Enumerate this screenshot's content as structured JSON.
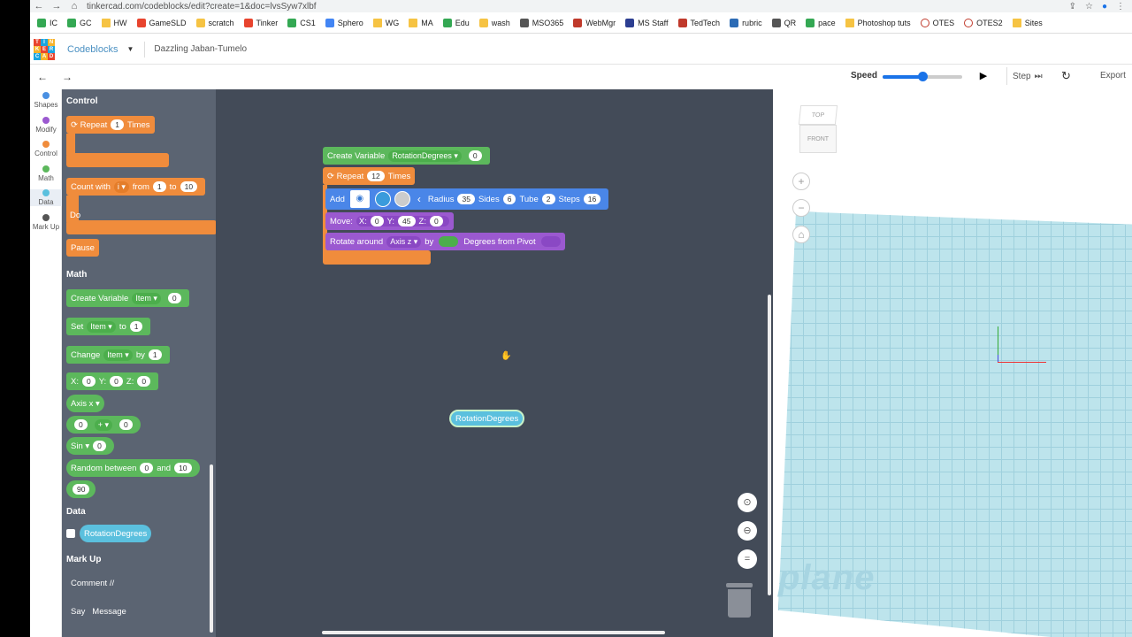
{
  "browser": {
    "url": "tinkercad.com/codeblocks/edit?create=1&doc=lvsSyw7xlbf",
    "bookmarks": [
      {
        "label": "IC",
        "color": "#34a853",
        "kind": "square"
      },
      {
        "label": "GC",
        "color": "#34a853",
        "kind": "square"
      },
      {
        "label": "HW",
        "color": "#f6c343",
        "kind": "folder"
      },
      {
        "label": "GameSLD",
        "color": "#e8442e",
        "kind": "square"
      },
      {
        "label": "scratch",
        "color": "#f6c343",
        "kind": "square"
      },
      {
        "label": "Tinker",
        "color": "#e8442e",
        "kind": "square"
      },
      {
        "label": "CS1",
        "color": "#34a853",
        "kind": "square"
      },
      {
        "label": "Sphero",
        "color": "#4285f4",
        "kind": "square"
      },
      {
        "label": "WG",
        "color": "#f6c343",
        "kind": "folder"
      },
      {
        "label": "MA",
        "color": "#f6c343",
        "kind": "folder"
      },
      {
        "label": "Edu",
        "color": "#34a853",
        "kind": "square"
      },
      {
        "label": "wash",
        "color": "#f6c343",
        "kind": "square"
      },
      {
        "label": "MSO365",
        "color": "#555555",
        "kind": "square"
      },
      {
        "label": "WebMgr",
        "color": "#c0392b",
        "kind": "square"
      },
      {
        "label": "MS Staff",
        "color": "#2c3e91",
        "kind": "square"
      },
      {
        "label": "TedTech",
        "color": "#c0392b",
        "kind": "square"
      },
      {
        "label": "rubric",
        "color": "#2c6bb5",
        "kind": "square"
      },
      {
        "label": "QR",
        "color": "#555555",
        "kind": "square"
      },
      {
        "label": "pace",
        "color": "#34a853",
        "kind": "square"
      },
      {
        "label": "Photoshop tuts",
        "color": "#f6c343",
        "kind": "folder"
      },
      {
        "label": "OTES",
        "color": "#c0392b",
        "kind": "ring"
      },
      {
        "label": "OTES2",
        "color": "#c0392b",
        "kind": "ring"
      },
      {
        "label": "Sites",
        "color": "#f6c343",
        "kind": "folder"
      }
    ]
  },
  "header": {
    "logo_letters": [
      "TIN",
      "KER",
      "CAD"
    ],
    "app_title": "Codeblocks",
    "project_name": "Dazzling Jaban-Tumelo"
  },
  "toolbar": {
    "undo": "←",
    "redo": "→",
    "speed_label": "Speed",
    "speed_value": 0.5,
    "step_label": "Step",
    "export_label": "Export"
  },
  "categories": [
    {
      "label": "Shapes",
      "color": "#4a90e2"
    },
    {
      "label": "Modify",
      "color": "#9b59d0"
    },
    {
      "label": "Control",
      "color": "#f08c3c"
    },
    {
      "label": "Math",
      "color": "#5cb85c"
    },
    {
      "label": "Data",
      "color": "#5bc0de"
    },
    {
      "label": "Mark Up",
      "color": "#555555"
    }
  ],
  "palette": {
    "control_heading": "Control",
    "repeat_label": "Repeat",
    "repeat_count": "1",
    "times_label": "Times",
    "count_with": "Count with",
    "count_var": "i",
    "from_label": "from",
    "from_val": "1",
    "to_label": "to",
    "to_val": "10",
    "do_label": "Do",
    "pause_label": "Pause",
    "math_heading": "Math",
    "create_var_label": "Create Variable",
    "create_var_name": "Item",
    "create_var_val": "0",
    "set_label": "Set",
    "set_var": "Item",
    "set_to": "to",
    "set_val": "1",
    "change_label": "Change",
    "change_var": "Item",
    "change_by": "by",
    "change_val": "1",
    "xyz_x": "X:",
    "xyz_x_val": "0",
    "xyz_y": "Y:",
    "xyz_y_val": "0",
    "xyz_z": "Z:",
    "xyz_z_val": "0",
    "axis_label": "Axis x",
    "op_a": "0",
    "op_sym": "+",
    "op_b": "0",
    "sin_label": "Sin",
    "sin_val": "0",
    "random_label": "Random between",
    "random_a": "0",
    "random_and": "and",
    "random_b": "10",
    "number_val": "90",
    "data_heading": "Data",
    "data_var": "RotationDegrees",
    "markup_heading": "Mark Up",
    "comment_label": "Comment //",
    "say_label": "Say",
    "say_message": "Message"
  },
  "workspace": {
    "create_var_label": "Create Variable",
    "create_var_name": "RotationDegrees",
    "create_var_val": "0",
    "repeat_label": "Repeat",
    "repeat_count": "12",
    "times_label": "Times",
    "add_label": "Add",
    "radius_label": "Radius",
    "radius_val": "35",
    "sides_label": "Sides",
    "sides_val": "6",
    "tube_label": "Tube",
    "tube_val": "2",
    "steps_label": "Steps",
    "steps_val": "16",
    "move_label": "Move:",
    "move_x_label": "X:",
    "move_x_val": "0",
    "move_y_label": "Y:",
    "move_y_val": "45",
    "move_z_label": "Z:",
    "move_z_val": "0",
    "rotate_label": "Rotate around",
    "rotate_axis": "Axis z",
    "rotate_by": "by",
    "rotate_degrees": "Degrees",
    "rotate_from": "from Pivot",
    "floating_var": "RotationDegrees",
    "shape_color": "#3a9bdc"
  },
  "viewport": {
    "cube_top": "TOP",
    "cube_front": "FRONT",
    "plane_label": "plane"
  }
}
